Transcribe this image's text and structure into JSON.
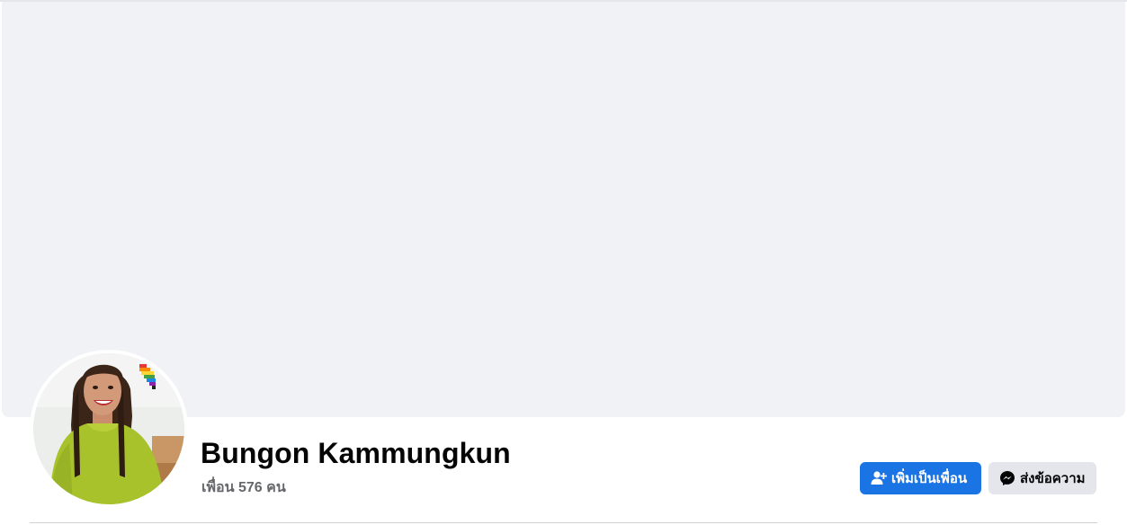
{
  "profile": {
    "name": "Bungon Kammungkun",
    "friends_text": "เพื่อน 576 คน"
  },
  "actions": {
    "add_friend_label": "เพิ่มเป็นเพื่อน",
    "message_label": "ส่งข้อความ"
  },
  "icons": {
    "add_friend": "person-plus-icon",
    "message": "messenger-icon"
  },
  "colors": {
    "primary_button": "#1b74e4",
    "secondary_button": "#e4e6eb",
    "cover_background": "#f0f2f5",
    "secondary_text": "#65676b"
  }
}
